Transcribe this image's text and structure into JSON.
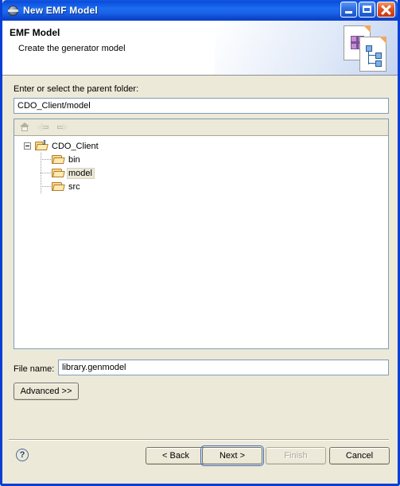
{
  "window": {
    "title": "New EMF Model",
    "icon": "eclipse-globe-icon",
    "controls": {
      "minimize": "minimize-button",
      "maximize": "maximize-button",
      "close": "close-button"
    }
  },
  "header": {
    "title": "EMF Model",
    "description": "Create the generator model",
    "icon": "emf-model-banner-icon"
  },
  "form": {
    "parent_folder_label": "Enter or select the parent folder:",
    "parent_folder_value": "CDO_Client/model",
    "file_name_label": "File name:",
    "file_name_value": "library.genmodel",
    "advanced_label": "Advanced >>"
  },
  "tree_toolbar": {
    "home": "home-icon",
    "back": "back-arrow-icon",
    "forward": "forward-arrow-icon"
  },
  "tree": {
    "root": {
      "label": "CDO_Client",
      "expanded": true,
      "icon": "java-project-folder-icon"
    },
    "children": [
      {
        "label": "bin",
        "icon": "folder-icon",
        "selected": false
      },
      {
        "label": "model",
        "icon": "folder-icon",
        "selected": true
      },
      {
        "label": "src",
        "icon": "folder-icon",
        "selected": false
      }
    ]
  },
  "footer": {
    "help": "?",
    "back_label": "< Back",
    "next_label": "Next >",
    "finish_label": "Finish",
    "cancel_label": "Cancel",
    "finish_disabled": true,
    "next_is_default": true
  },
  "colors": {
    "title_bar_blue": "#0b4ddc",
    "frame_blue": "#0a3fd4",
    "dialog_bg": "#ece9d8",
    "field_border": "#7f9db9",
    "selection_bg": "#ede9d8",
    "close_button_red": "#c8340d"
  }
}
